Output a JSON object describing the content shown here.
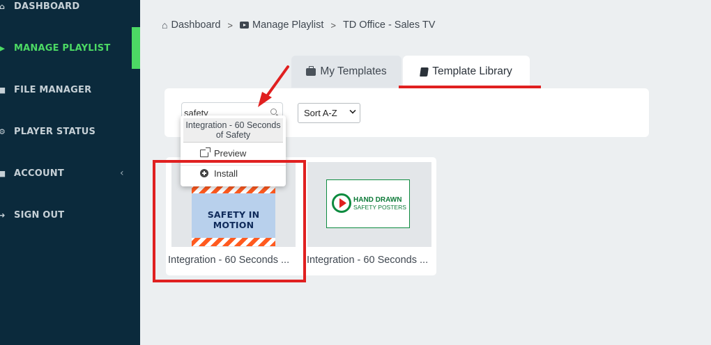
{
  "sidebar": {
    "items": [
      {
        "label": "DASHBOARD",
        "icon": "home-icon"
      },
      {
        "label": "MANAGE PLAYLIST",
        "icon": "play-icon",
        "active": true
      },
      {
        "label": "FILE MANAGER",
        "icon": "folder-icon"
      },
      {
        "label": "PLAYER STATUS",
        "icon": "cogs-icon"
      },
      {
        "label": "ACCOUNT",
        "icon": "briefcase-icon",
        "chevron": "‹"
      },
      {
        "label": "SIGN OUT",
        "icon": "sign-out-icon"
      }
    ],
    "accent_color": "#4cd964",
    "background_color": "#0b2a3c"
  },
  "breadcrumb": {
    "items": [
      "Dashboard",
      "Manage Playlist",
      "TD Office - Sales TV"
    ],
    "separator": ">"
  },
  "tabs": [
    {
      "label": "My Templates",
      "icon": "briefcase-icon",
      "active": false
    },
    {
      "label": "Template Library",
      "icon": "book-icon",
      "active": true
    }
  ],
  "search": {
    "value": "safety",
    "placeholder": ""
  },
  "sort": {
    "selected": "Sort A-Z"
  },
  "popup": {
    "title": "Integration - 60 Seconds of Safety",
    "items": [
      {
        "label": "Preview",
        "icon": "external-link-icon"
      },
      {
        "label": "Install",
        "icon": "plus-circle-icon"
      }
    ]
  },
  "templates": [
    {
      "title": "Integration - 60 Seconds of Safety",
      "title_display": "Integration - 60 Seconds ...",
      "thumbnail_text": "SAFETY IN MOTION"
    },
    {
      "title": "Integration - 60 Seconds of Safety",
      "title_display": "Integration - 60 Seconds ...",
      "thumbnail_text": "HAND DRAWN",
      "thumbnail_subtext": "SAFETY POSTERS"
    }
  ],
  "annotation_color": "#e02020"
}
